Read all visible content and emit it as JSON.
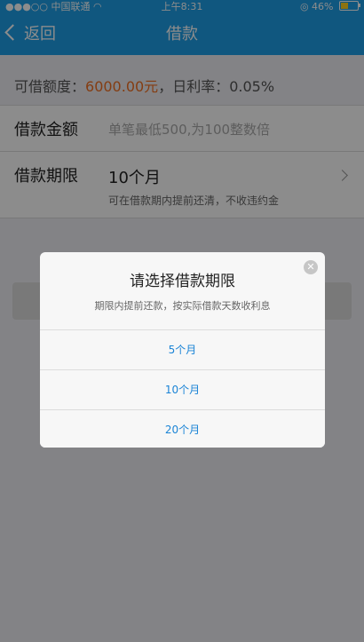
{
  "status_bar": {
    "signal": "●●●○○",
    "carrier": "中国联通",
    "time": "上午8:31",
    "battery": "46%"
  },
  "nav": {
    "back_label": "返回",
    "title": "借款"
  },
  "rate_row": {
    "prefix": "可借额度：",
    "amount": "6000.00元",
    "suffix": "，日利率：0.05%"
  },
  "loan_amount": {
    "label": "借款金额",
    "placeholder": "单笔最低500,为100整数倍"
  },
  "loan_term": {
    "label": "借款期限",
    "value": "10个月",
    "hint": "可在借款期内提前还清，不收违约金"
  },
  "modal": {
    "title": "请选择借款期限",
    "subtitle": "期限内提前还款，按实际借款天数收利息",
    "options": [
      "5个月",
      "10个月",
      "20个月"
    ]
  },
  "colors": {
    "primary": "#1e9ee8",
    "amount": "#f06f22",
    "option_text": "#1b84d6"
  }
}
